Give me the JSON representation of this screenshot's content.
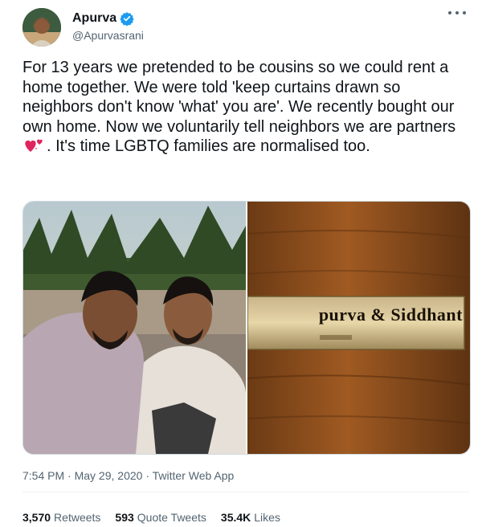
{
  "author": {
    "display_name": "Apurva",
    "handle": "@Apurvasrani",
    "verified_icon": "verified-badge-icon",
    "accent_color": "#1d9bf0"
  },
  "tweet": {
    "text_before_emoji": "For 13 years we pretended to be cousins so we could rent a home together. We were told 'keep curtains drawn so neighbors don't know 'what' you are'. We recently bought our own home. Now we voluntarily tell neighbors we are partners ",
    "emoji": "heart-emoji",
    "text_after_emoji": ". It's time LGBTQ families are normalised too."
  },
  "media": {
    "left_photo": "two-men-selfie-photo",
    "right_photo": "door-nameplate-photo",
    "nameplate_text": "purva & Siddhant"
  },
  "meta": {
    "time": "7:54 PM",
    "separator": " · ",
    "date": "May 29, 2020",
    "source": "Twitter Web App"
  },
  "stats": {
    "retweets_count": "3,570",
    "retweets_label": "Retweets",
    "quote_count": "593",
    "quote_label": "Quote Tweets",
    "likes_count": "35.4K",
    "likes_label": "Likes"
  }
}
